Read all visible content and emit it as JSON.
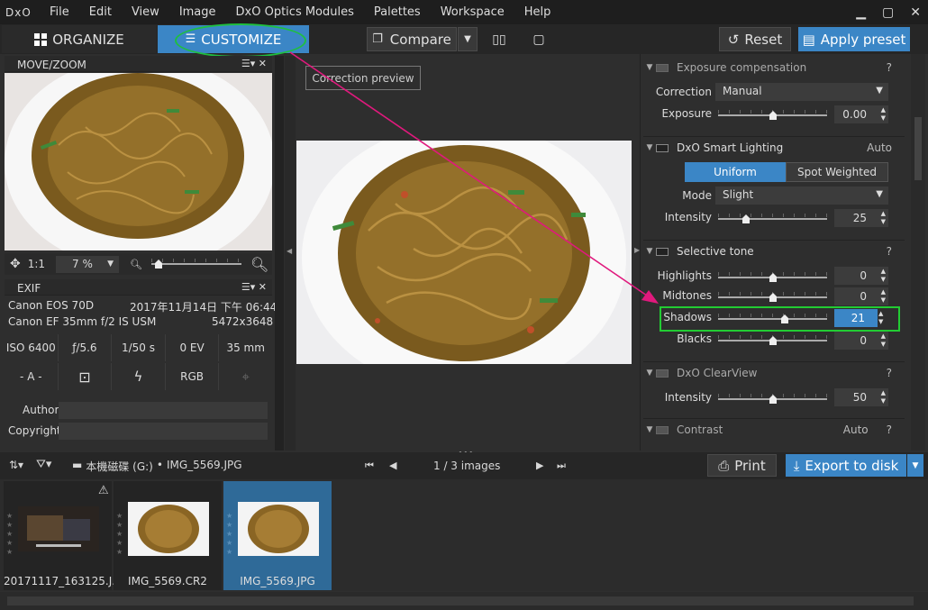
{
  "app": {
    "logo": "DxO"
  },
  "menu": [
    "File",
    "Edit",
    "View",
    "Image",
    "DxO Optics Modules",
    "Palettes",
    "Workspace",
    "Help"
  ],
  "toolbar": {
    "organize": "ORGANIZE",
    "customize": "CUSTOMIZE",
    "compare": "Compare",
    "reset": "Reset",
    "apply_preset": "Apply preset"
  },
  "move_zoom": {
    "title": "MOVE/ZOOM",
    "ratio": "1:1",
    "zoom_value": "7 %"
  },
  "exif": {
    "title": "EXIF",
    "camera": "Canon EOS 70D",
    "date": "2017年11月14日 下午 06:44",
    "lens": "Canon EF 35mm f/2 IS USM",
    "dimensions": "5472x3648",
    "iso": "ISO 6400",
    "aperture": "ƒ/5.6",
    "shutter": "1/50 s",
    "ev": "0 EV",
    "focal": "35 mm",
    "mode": "- A -",
    "color": "RGB",
    "author_label": "Author",
    "copyright_label": "Copyright",
    "author_value": "",
    "copyright_value": ""
  },
  "center": {
    "correction_preview": "Correction preview"
  },
  "palette": {
    "exposure": {
      "title": "Exposure compensation",
      "help": "?",
      "correction_label": "Correction",
      "correction_value": "Manual",
      "exposure_label": "Exposure",
      "exposure_value": "0.00"
    },
    "smart_lighting": {
      "title": "DxO Smart Lighting",
      "status": "Auto",
      "mode_uniform": "Uniform",
      "mode_spot": "Spot Weighted",
      "mode_label": "Mode",
      "mode_value": "Slight",
      "intensity_label": "Intensity",
      "intensity_value": "25"
    },
    "selective_tone": {
      "title": "Selective tone",
      "help": "?",
      "highlights_label": "Highlights",
      "highlights_value": "0",
      "midtones_label": "Midtones",
      "midtones_value": "0",
      "shadows_label": "Shadows",
      "shadows_value": "21",
      "blacks_label": "Blacks",
      "blacks_value": "0"
    },
    "clearview": {
      "title": "DxO ClearView",
      "help": "?",
      "intensity_label": "Intensity",
      "intensity_value": "50"
    },
    "contrast": {
      "title": "Contrast",
      "status": "Auto",
      "help": "?"
    }
  },
  "filebar": {
    "path_drive": "本機磁碟 (G:)",
    "path_file": "IMG_5569.JPG",
    "counter": "1 / 3  images",
    "print": "Print",
    "export": "Export to disk"
  },
  "filmstrip": [
    {
      "name": "20171117_163125.J..."
    },
    {
      "name": "IMG_5569.CR2"
    },
    {
      "name": "IMG_5569.JPG"
    }
  ],
  "colors": {
    "accent": "#3b86c6",
    "highlight_green": "#22cc33",
    "annotation_arrow": "#e0197d"
  }
}
